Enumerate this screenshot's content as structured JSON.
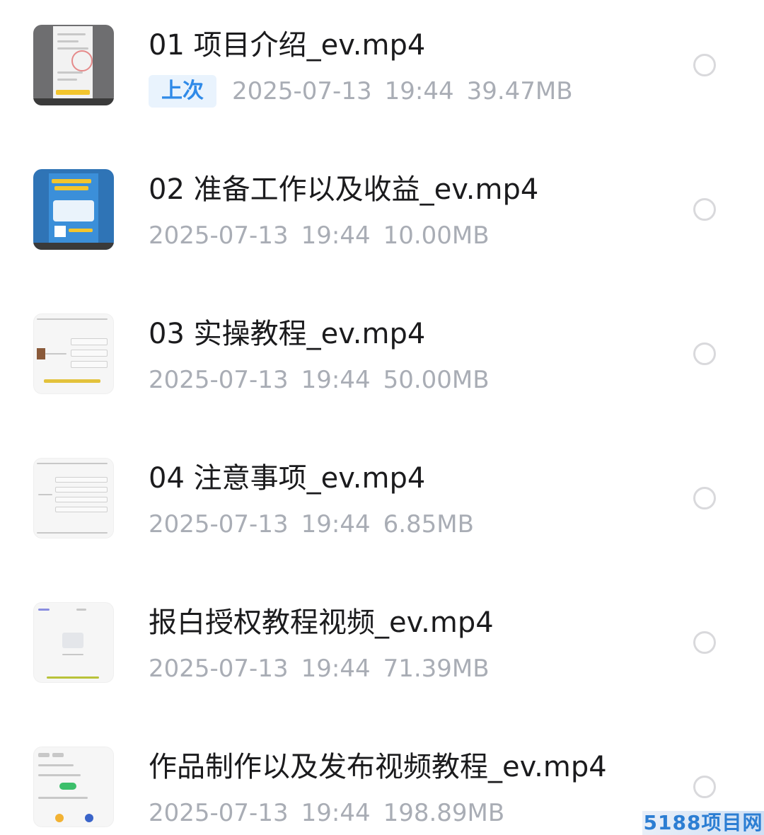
{
  "files": [
    {
      "name": "01 项目介绍_ev.mp4",
      "badge": "上次",
      "date": "2025-07-13",
      "time": "19:44",
      "size": "39.47MB",
      "thumbnail": "document-thumbnail-icon"
    },
    {
      "name": "02 准备工作以及收益_ev.mp4",
      "badge": "",
      "date": "2025-07-13",
      "time": "19:44",
      "size": "10.00MB",
      "thumbnail": "promo-poster-thumbnail-icon"
    },
    {
      "name": "03 实操教程_ev.mp4",
      "badge": "",
      "date": "2025-07-13",
      "time": "19:44",
      "size": "50.00MB",
      "thumbnail": "mindmap-thumbnail-icon"
    },
    {
      "name": "04 注意事项_ev.mp4",
      "badge": "",
      "date": "2025-07-13",
      "time": "19:44",
      "size": "6.85MB",
      "thumbnail": "mindmap-thumbnail-icon"
    },
    {
      "name": "报白授权教程视频_ev.mp4",
      "badge": "",
      "date": "2025-07-13",
      "time": "19:44",
      "size": "71.39MB",
      "thumbnail": "empty-state-thumbnail-icon"
    },
    {
      "name": "作品制作以及发布视频教程_ev.mp4",
      "badge": "",
      "date": "2025-07-13",
      "time": "19:44",
      "size": "198.89MB",
      "thumbnail": "app-screen-thumbnail-icon"
    }
  ],
  "watermark": "5188项目网",
  "colors": {
    "title": "#1b1b1d",
    "meta": "#a9adb5",
    "badge_text": "#2f8ae8",
    "badge_bg": "#e9f3fd",
    "radio_border": "#d9d9dc"
  }
}
